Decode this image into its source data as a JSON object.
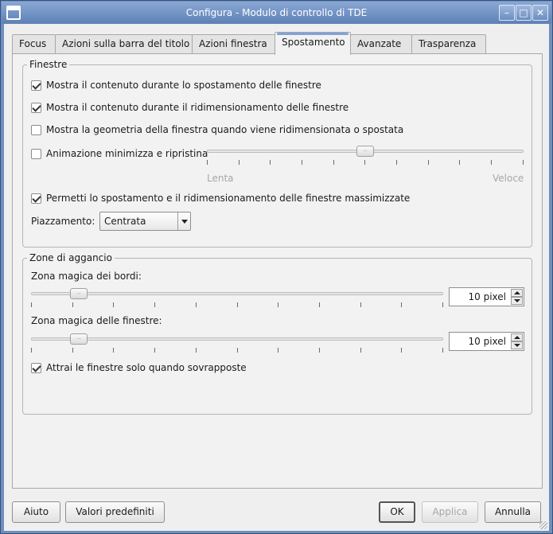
{
  "window": {
    "title": "Configura - Modulo di controllo di TDE",
    "minimize_glyph": "–",
    "maximize_glyph": "□",
    "close_glyph": "✕"
  },
  "tabs": [
    {
      "label": "Focus"
    },
    {
      "label": "Azioni sulla barra del titolo"
    },
    {
      "label": "Azioni finestra"
    },
    {
      "label": "Spostamento"
    },
    {
      "label": "Avanzate"
    },
    {
      "label": "Trasparenza"
    }
  ],
  "finestre": {
    "title": "Finestre",
    "opt_show_content_move": {
      "label": "Mostra il contenuto durante lo spostamento delle finestre",
      "checked": true
    },
    "opt_show_content_resize": {
      "label": "Mostra il contenuto durante il ridimensionamento delle finestre",
      "checked": true
    },
    "opt_show_geometry": {
      "label": "Mostra la geometria della finestra quando viene ridimensionata o spostata",
      "checked": false
    },
    "opt_animation": {
      "label": "Animazione minimizza e ripristina",
      "checked": false
    },
    "anim_slider": {
      "min_label": "Lenta",
      "max_label": "Veloce",
      "level": 0.5
    },
    "opt_maximized": {
      "label": "Permetti lo spostamento e il ridimensionamento delle finestre massimizzate",
      "checked": true
    },
    "placement_label": "Piazzamento:",
    "placement_value": "Centrata"
  },
  "snap": {
    "title": "Zone di aggancio",
    "border_label": "Zona magica dei bordi:",
    "border_value": "10 pixel",
    "border_level": 0.1,
    "window_label": "Zona magica delle finestre:",
    "window_value": "10 pixel",
    "window_level": 0.1,
    "opt_overlap": {
      "label": "Attrai le finestre solo quando sovrapposte",
      "checked": true
    }
  },
  "buttons": {
    "help": "Aiuto",
    "defaults": "Valori predefiniti",
    "ok": "OK",
    "apply": "Applica",
    "cancel": "Annulla"
  }
}
